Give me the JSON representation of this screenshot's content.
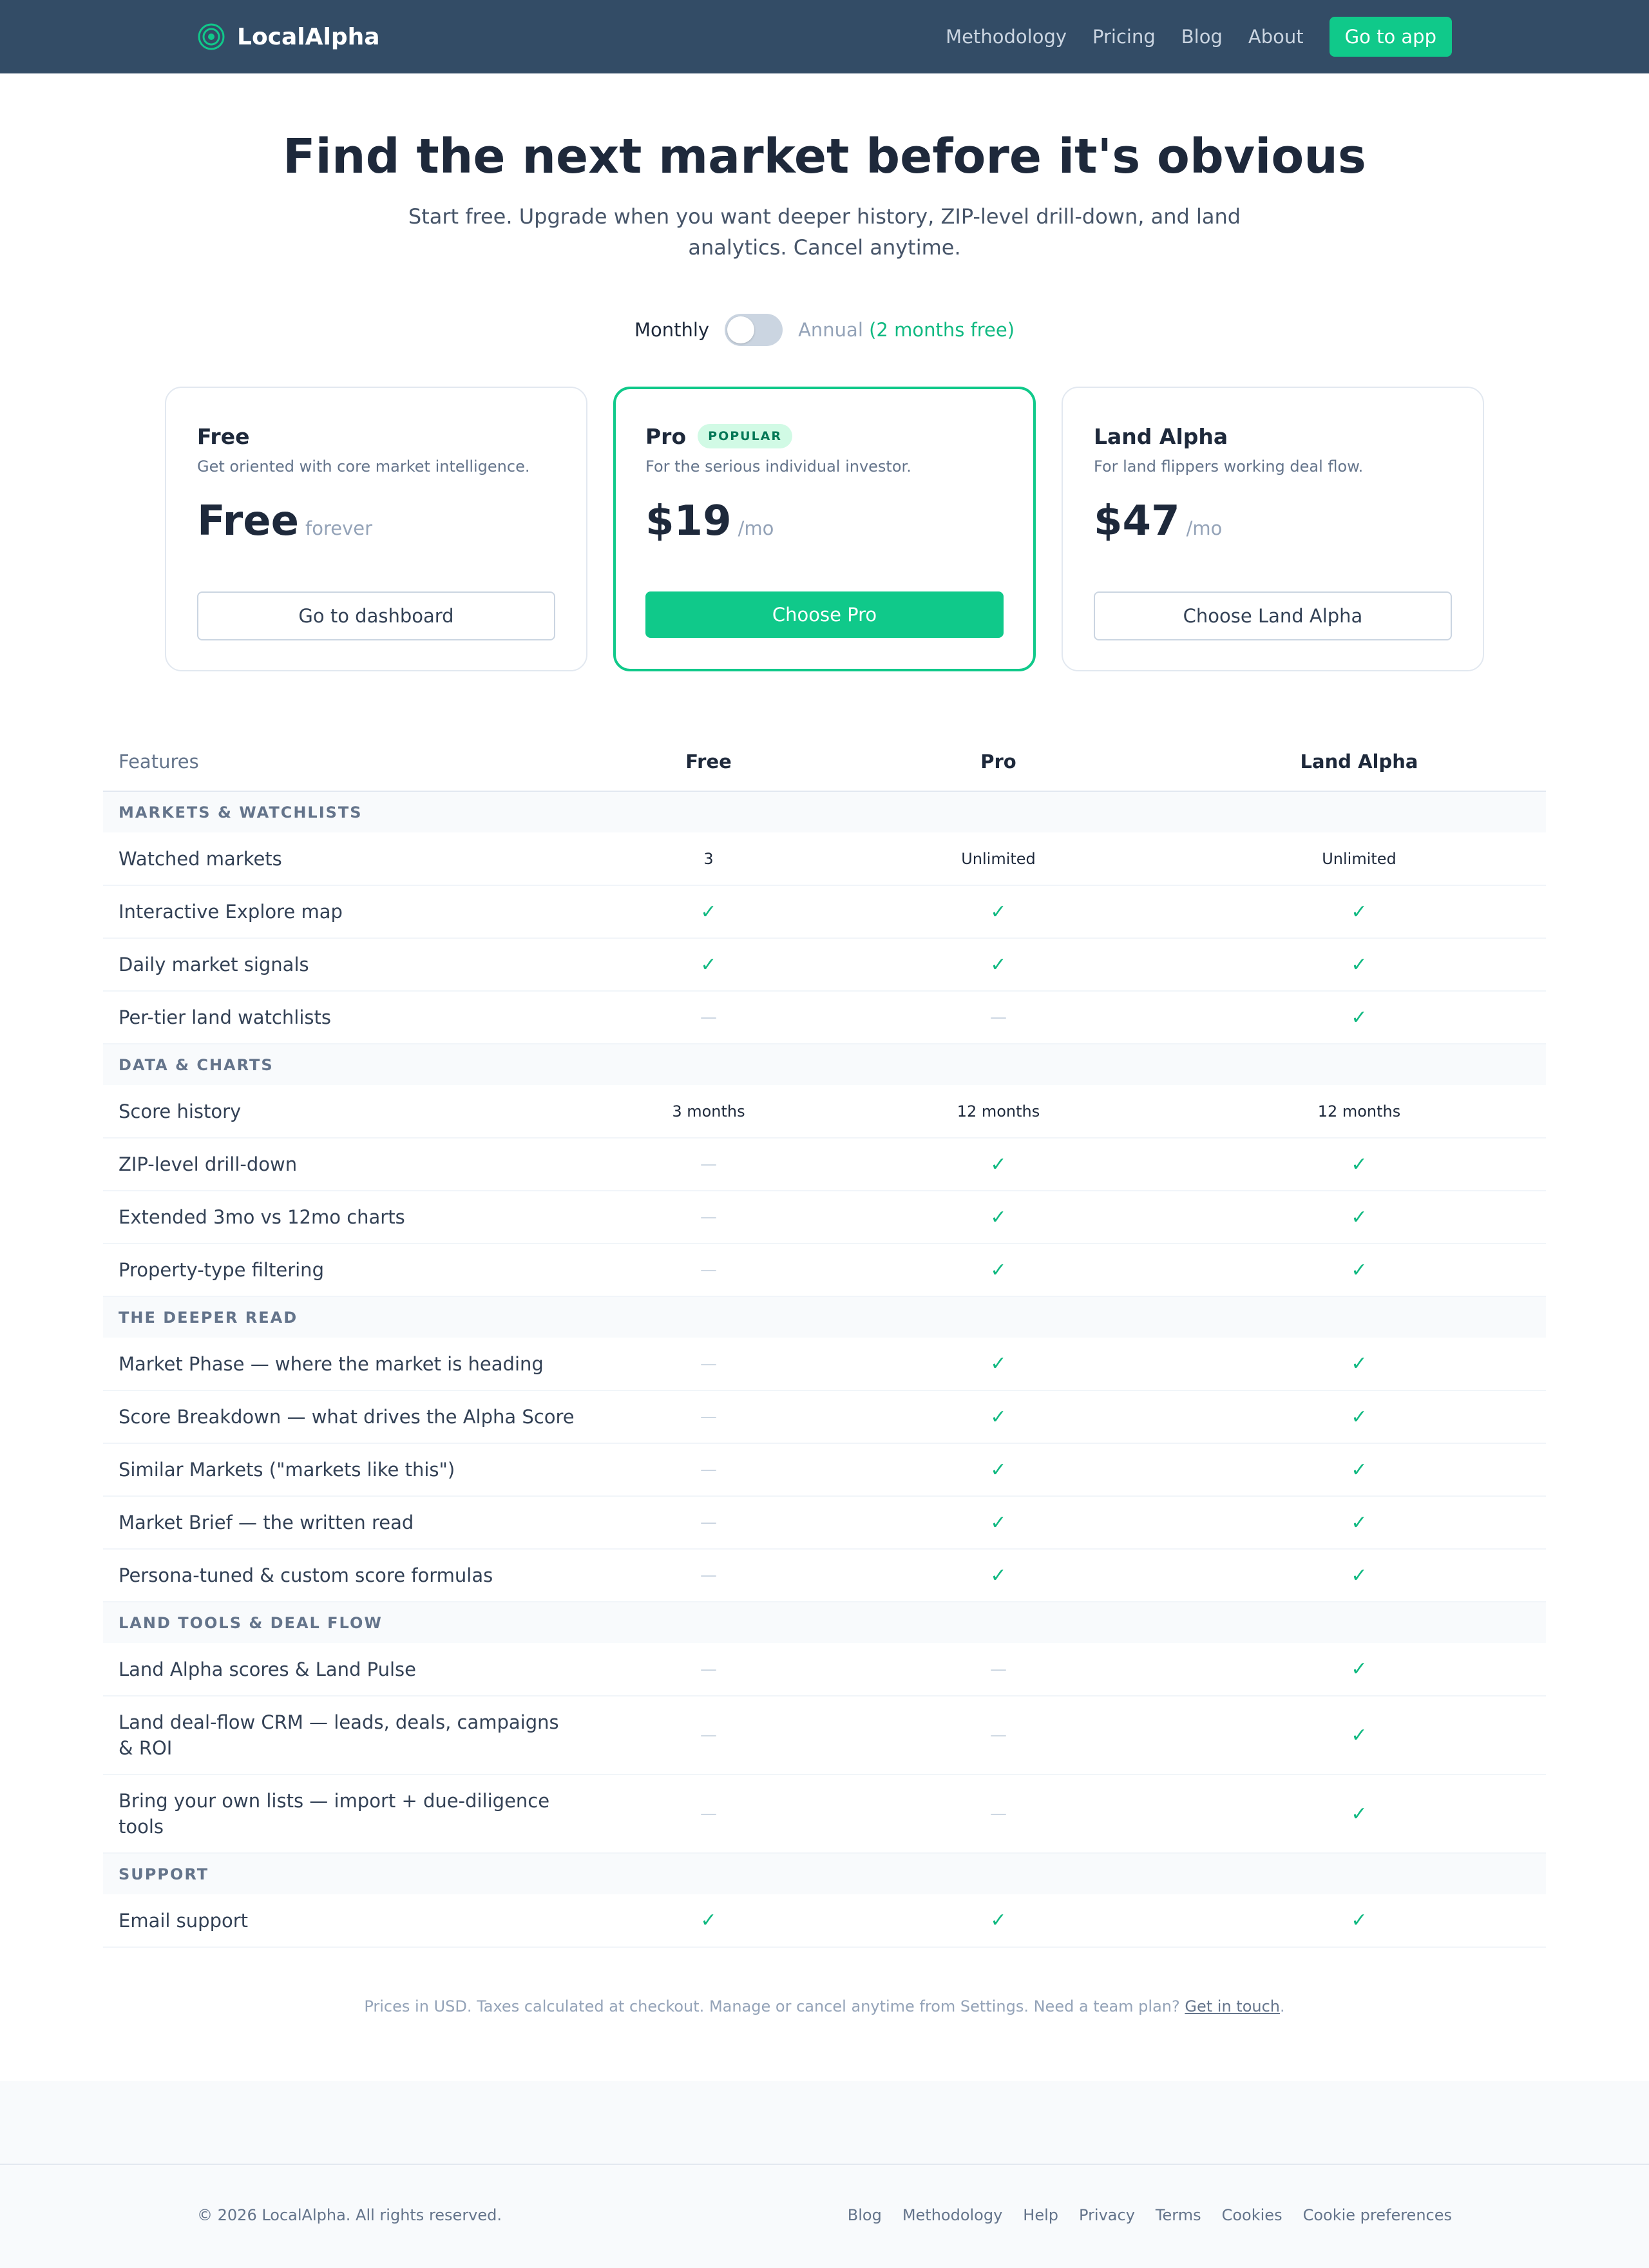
{
  "brand": {
    "name": "LocalAlpha",
    "logo_icon": "target-icon",
    "accent": "#10c98a"
  },
  "nav": {
    "links": [
      "Methodology",
      "Pricing",
      "Blog",
      "About"
    ],
    "cta": "Go to app"
  },
  "hero": {
    "title": "Find the next market before it's obvious",
    "subtitle": "Start free. Upgrade when you want deeper history, ZIP-level drill-down, and land analytics. Cancel anytime."
  },
  "billing_toggle": {
    "monthly_label": "Monthly",
    "annual_label": "Annual",
    "annual_note": "(2 months free)",
    "selected": "Monthly"
  },
  "plans": [
    {
      "name": "Free",
      "badge": "",
      "description": "Get oriented with core market intelligence.",
      "price": "Free",
      "period": "forever",
      "button": "Go to dashboard"
    },
    {
      "name": "Pro",
      "badge": "POPULAR",
      "description": "For the serious individual investor.",
      "price": "$19",
      "period": "/mo",
      "button": "Choose Pro"
    },
    {
      "name": "Land Alpha",
      "badge": "",
      "description": "For land flippers working deal flow.",
      "price": "$47",
      "period": "/mo",
      "button": "Choose Land Alpha"
    }
  ],
  "features_table": {
    "headers": [
      "Features",
      "Free",
      "Pro",
      "Land Alpha"
    ],
    "sections": [
      {
        "title": "MARKETS & WATCHLISTS",
        "rows": [
          {
            "feature": "Watched markets",
            "values": [
              "3",
              "Unlimited",
              "Unlimited"
            ]
          },
          {
            "feature": "Interactive Explore map",
            "values": [
              "check",
              "check",
              "check"
            ]
          },
          {
            "feature": "Daily market signals",
            "values": [
              "check",
              "check",
              "check"
            ]
          },
          {
            "feature": "Per-tier land watchlists",
            "values": [
              "dash",
              "dash",
              "check"
            ]
          }
        ]
      },
      {
        "title": "DATA & CHARTS",
        "rows": [
          {
            "feature": "Score history",
            "values": [
              "3 months",
              "12 months",
              "12 months"
            ]
          },
          {
            "feature": "ZIP-level drill-down",
            "values": [
              "dash",
              "check",
              "check"
            ]
          },
          {
            "feature": "Extended 3mo vs 12mo charts",
            "values": [
              "dash",
              "check",
              "check"
            ]
          },
          {
            "feature": "Property-type filtering",
            "values": [
              "dash",
              "check",
              "check"
            ]
          }
        ]
      },
      {
        "title": "THE DEEPER READ",
        "rows": [
          {
            "feature": "Market Phase — where the market is heading",
            "values": [
              "dash",
              "check",
              "check"
            ]
          },
          {
            "feature": "Score Breakdown — what drives the Alpha Score",
            "values": [
              "dash",
              "check",
              "check"
            ]
          },
          {
            "feature": "Similar Markets (\"markets like this\")",
            "values": [
              "dash",
              "check",
              "check"
            ]
          },
          {
            "feature": "Market Brief — the written read",
            "values": [
              "dash",
              "check",
              "check"
            ]
          },
          {
            "feature": "Persona-tuned & custom score formulas",
            "values": [
              "dash",
              "check",
              "check"
            ]
          }
        ]
      },
      {
        "title": "LAND TOOLS & DEAL FLOW",
        "rows": [
          {
            "feature": "Land Alpha scores & Land Pulse",
            "values": [
              "dash",
              "dash",
              "check"
            ]
          },
          {
            "feature": "Land deal-flow CRM — leads, deals, campaigns & ROI",
            "values": [
              "dash",
              "dash",
              "check"
            ]
          },
          {
            "feature": "Bring your own lists — import + due-diligence tools",
            "values": [
              "dash",
              "dash",
              "check"
            ]
          }
        ]
      },
      {
        "title": "SUPPORT",
        "rows": [
          {
            "feature": "Email support",
            "values": [
              "check",
              "check",
              "check"
            ]
          }
        ]
      }
    ]
  },
  "footnote": {
    "text": "Prices in USD. Taxes calculated at checkout. Manage or cancel anytime from Settings. Need a team plan?",
    "link": "Get in touch",
    "end": "."
  },
  "footer": {
    "copyright": "© 2026 LocalAlpha. All rights reserved.",
    "links": [
      "Blog",
      "Methodology",
      "Help",
      "Privacy",
      "Terms",
      "Cookies",
      "Cookie preferences"
    ]
  }
}
